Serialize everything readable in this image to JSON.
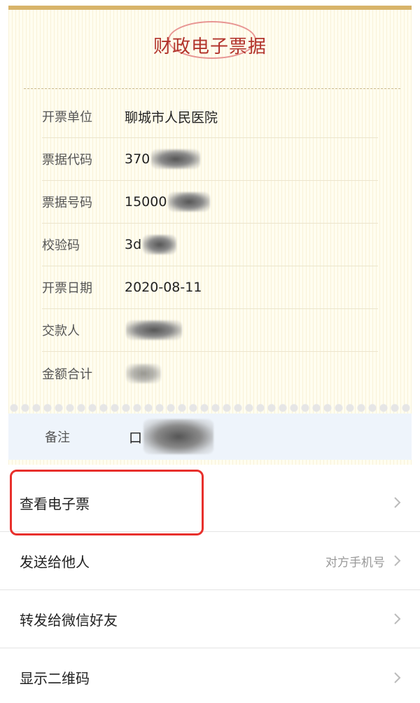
{
  "receipt": {
    "title": "财政电子票据",
    "fields": [
      {
        "label": "开票单位",
        "value": "聊城市人民医院"
      },
      {
        "label": "票据代码",
        "value": "370"
      },
      {
        "label": "票据号码",
        "value": "15000"
      },
      {
        "label": "校验码",
        "value": "3d"
      },
      {
        "label": "开票日期",
        "value": "2020-08-11"
      },
      {
        "label": "交款人",
        "value": ""
      },
      {
        "label": "金额合计",
        "value": ""
      }
    ],
    "remark": {
      "label": "备注",
      "value": "口"
    }
  },
  "menu": {
    "items": [
      {
        "label": "查看电子票",
        "hint": ""
      },
      {
        "label": "发送给他人",
        "hint": "对方手机号"
      },
      {
        "label": "转发给微信好友",
        "hint": ""
      },
      {
        "label": "显示二维码",
        "hint": ""
      }
    ]
  },
  "colors": {
    "title": "#b2342c",
    "highlight": "#e8302c",
    "top_bar": "#d8b46a"
  }
}
